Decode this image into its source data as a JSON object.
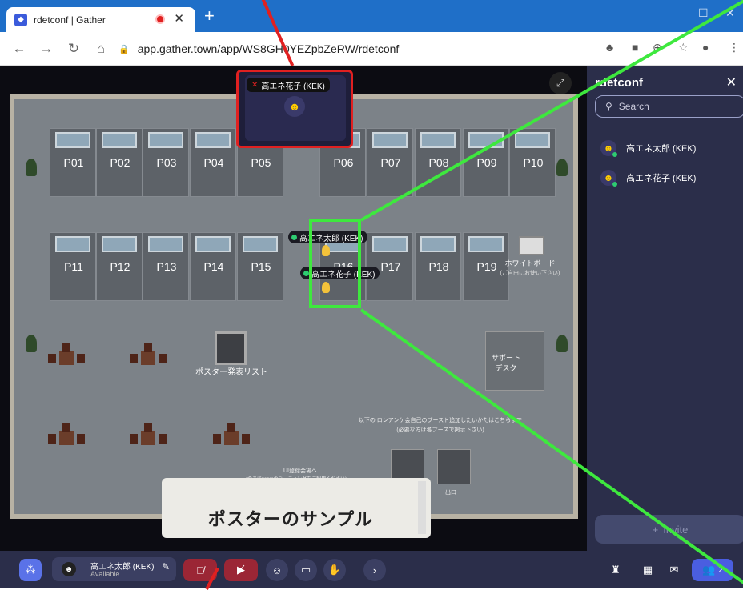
{
  "browser": {
    "tab_title": "rdetconf | Gather",
    "new_tab": "+",
    "url": "app.gather.town/app/WS8GH0YEZpbZeRW/rdetconf"
  },
  "booths_top": [
    "P01",
    "P02",
    "P03",
    "P04",
    "P05",
    "P06",
    "P07",
    "P08",
    "P09",
    "P10"
  ],
  "booths_bottom": [
    "P11",
    "P12",
    "P13",
    "P14",
    "P15",
    "P16",
    "P17",
    "P18",
    "P19"
  ],
  "map_labels": {
    "whiteboard": "ホワイトボード",
    "whiteboard_note": "(ご自由にお使い下さい)",
    "poster_list": "ポスター発表リスト",
    "support_desk": "サポート\nデスク",
    "notice": "以下の ロンアンケ会自己のブースト追加したいかたはこちらまで",
    "notice2": "(必要な方は各ブースで掲示下さい)",
    "meeting": "UI登録会場へ",
    "meeting2": "(今までzoomのミーティングをご利用ください)",
    "exit": "出口"
  },
  "video_tile": {
    "name": "高エネ花子 (KEK)"
  },
  "avatars": {
    "taro": "高エネ太郎 (KEK)",
    "hanako": "高エネ花子 (KEK)"
  },
  "poster_overlay": {
    "text": "ポスターのサンプル"
  },
  "panel": {
    "title": "rdetconf",
    "search_placeholder": "Search",
    "members": [
      "高エネ太郎 (KEK)",
      "高エネ花子 (KEK)"
    ],
    "invite": "Invite"
  },
  "bottom": {
    "user_name": "高エネ太郎 (KEK)",
    "user_status": "Available",
    "participants_count": "2"
  },
  "colors": {
    "annotation_red": "#e02020",
    "annotation_green": "#3ee83e",
    "panel_bg": "#2b2e4a"
  }
}
